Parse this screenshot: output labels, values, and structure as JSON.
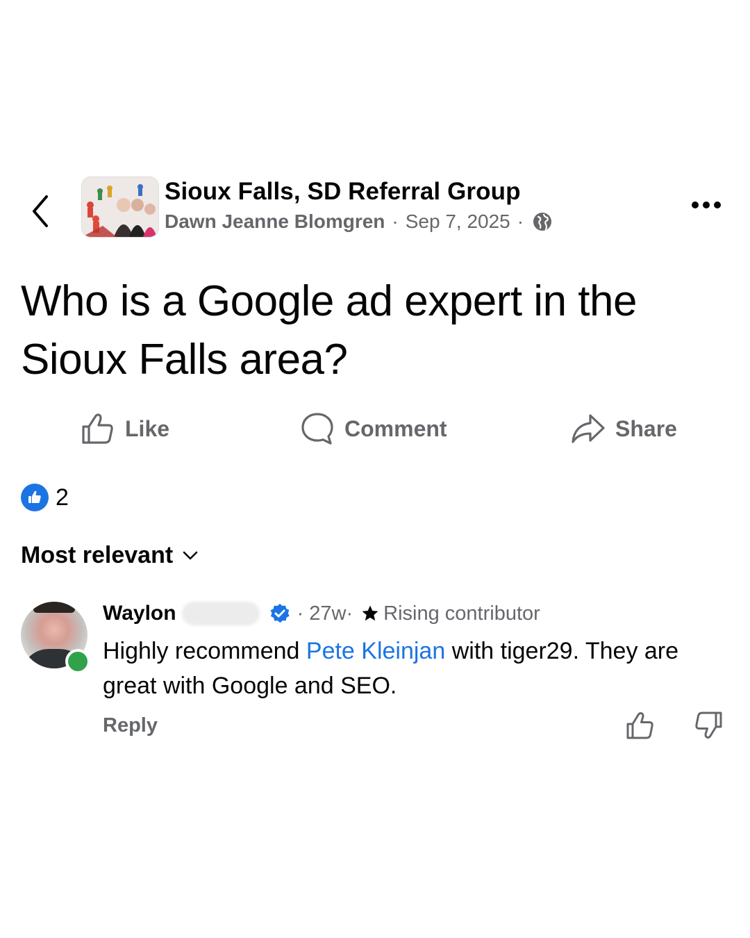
{
  "header": {
    "group_name": "Sioux Falls, SD Referral Group",
    "author": "Dawn Jeanne Blomgren",
    "separator": "·",
    "date": "Sep 7, 2025",
    "privacy_icon": "globe-icon"
  },
  "post": {
    "text": "Who is a Google ad expert in the Sioux Falls area?"
  },
  "actions": {
    "like_label": "Like",
    "comment_label": "Comment",
    "share_label": "Share"
  },
  "reactions": {
    "count": "2",
    "icon": "like-reaction-icon"
  },
  "sort": {
    "label": "Most relevant"
  },
  "comment": {
    "author": "Waylon",
    "time": "· 27w·",
    "badge": "Rising contributor",
    "text_before": "Highly recommend ",
    "mention": "Pete Kleinjan",
    "text_after": " with tiger29. They are great with Google and SEO.",
    "reply_label": "Reply"
  },
  "colors": {
    "accent": "#1b74e4",
    "secondary_text": "#65676b",
    "online": "#31a24c"
  }
}
